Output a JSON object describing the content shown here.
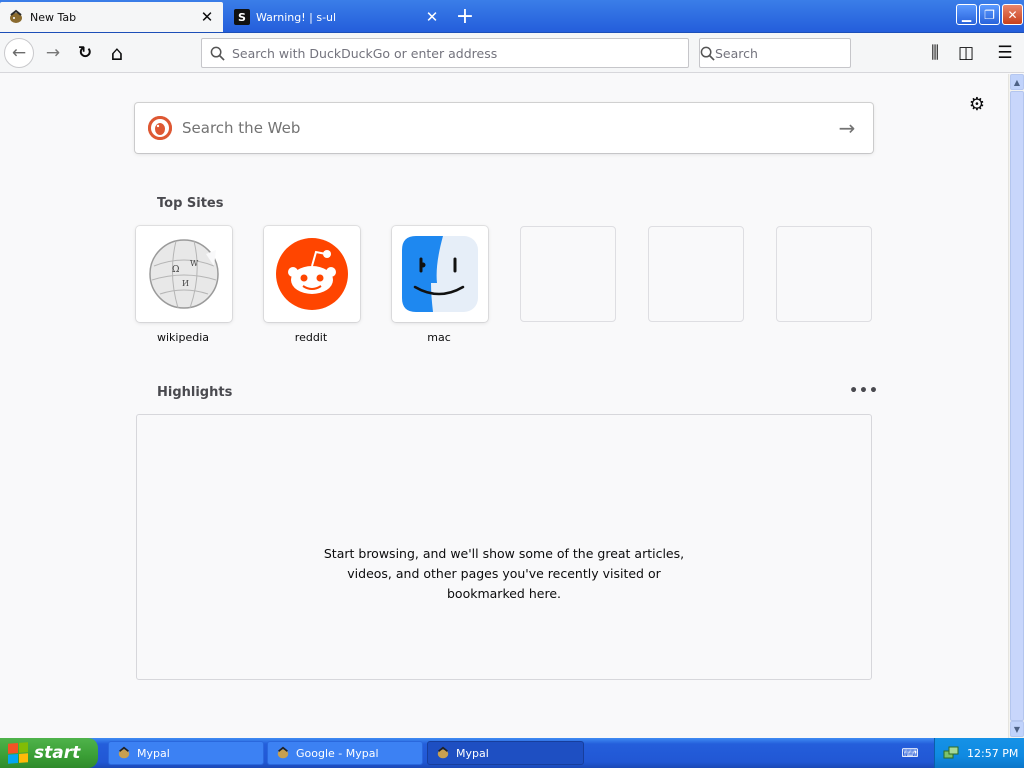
{
  "tabs": [
    {
      "label": "New Tab",
      "icon": "mypal-favicon",
      "active": true
    },
    {
      "label": "Warning! | s-ul",
      "icon": "s-favicon",
      "favicon_letter": "S",
      "active": false
    }
  ],
  "window": {
    "minimize_glyph": "▁",
    "restore_glyph": "❐",
    "close_glyph": "✕"
  },
  "nav": {
    "back_glyph": "←",
    "forward_glyph": "→",
    "reload_glyph": "↻",
    "home_glyph": "⌂",
    "url_placeholder": "Search with DuckDuckGo or enter address",
    "search_placeholder": "Search",
    "library_glyph": "⫼",
    "sidebar_glyph": "◫",
    "menu_glyph": "☰"
  },
  "page": {
    "gear_glyph": "⚙",
    "search_placeholder": "Search the Web",
    "search_go_glyph": "→",
    "top_sites_title": "Top Sites",
    "top_sites": [
      {
        "label": "wikipedia",
        "icon": "wikipedia-logo"
      },
      {
        "label": "reddit",
        "icon": "reddit-logo"
      },
      {
        "label": "mac",
        "icon": "finder-logo"
      },
      {
        "label": "",
        "icon": ""
      },
      {
        "label": "",
        "icon": ""
      },
      {
        "label": "",
        "icon": ""
      }
    ],
    "highlights_title": "Highlights",
    "highlights_more": "•••",
    "highlights_empty": "Start browsing, and we'll show some of the great articles, videos, and other pages you've recently visited or bookmarked here."
  },
  "taskbar": {
    "start_label": "start",
    "items": [
      {
        "label": "Mypal",
        "active": false
      },
      {
        "label": "Google - Mypal",
        "active": false
      },
      {
        "label": "Mypal",
        "active": true
      }
    ],
    "clock": "12:57 PM"
  },
  "colors": {
    "reddit": "#ff4500",
    "ddg": "#de5833",
    "finder": "#1e88f0"
  }
}
